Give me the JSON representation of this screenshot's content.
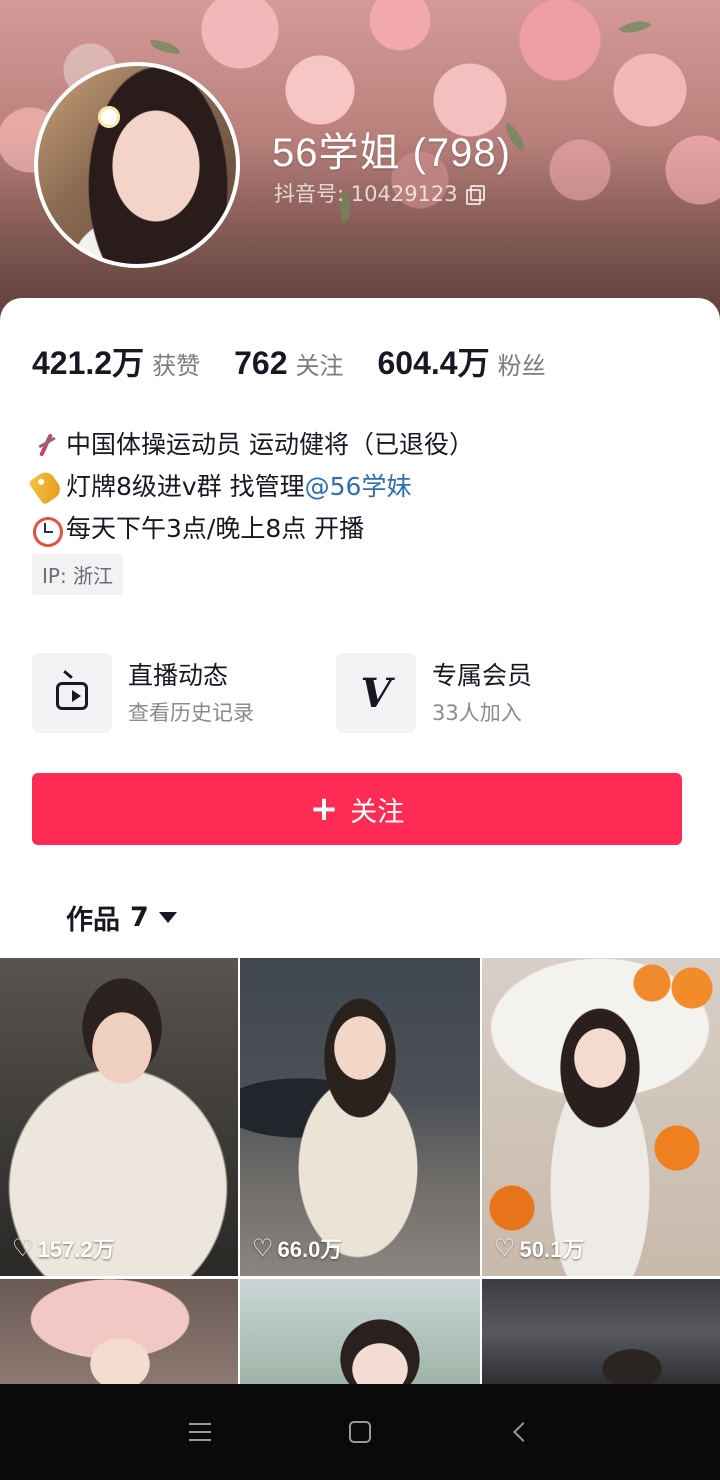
{
  "profile": {
    "name": "56学姐 (798)",
    "uid": "抖音号: 10429123"
  },
  "stats": [
    {
      "value": "421.2万",
      "label": "获赞"
    },
    {
      "value": "762",
      "label": "关注"
    },
    {
      "value": "604.4万",
      "label": "粉丝"
    }
  ],
  "bio": {
    "line1": "中国体操运动员 运动健将（已退役）",
    "line2_prefix": "灯牌8级进v群 找管理",
    "line2_mention": "@56学妹",
    "line3": "每天下午3点/晚上8点 开播"
  },
  "ip_tag": "IP: 浙江",
  "features": [
    {
      "title": "直播动态",
      "subtitle": "查看历史记录",
      "icon": "tv-icon"
    },
    {
      "title": "专属会员",
      "subtitle": "33人加入",
      "icon": "v-icon"
    }
  ],
  "follow_button": {
    "plus": "+",
    "label": "关注",
    "color": "#fe2c55"
  },
  "works_tab": {
    "label": "作品",
    "count": "7"
  },
  "videos": [
    {
      "likes": "157.2万"
    },
    {
      "likes": "66.0万"
    },
    {
      "likes": "50.1万"
    },
    {
      "likes": ""
    },
    {
      "likes": ""
    },
    {
      "likes": ""
    }
  ],
  "icons": {
    "heart": "♡",
    "v_glyph": "V"
  }
}
